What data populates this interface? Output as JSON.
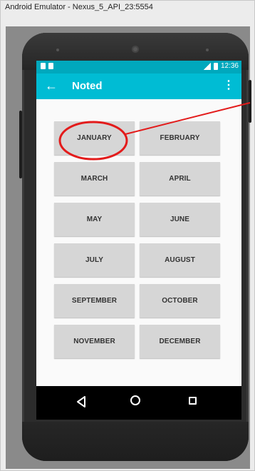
{
  "window": {
    "title": "Android Emulator - Nexus_5_API_23:5554"
  },
  "status_bar": {
    "time": "12:36"
  },
  "app_bar": {
    "title": "Noted",
    "back_icon": "arrow-back-icon",
    "overflow_icon": "more-vert-icon"
  },
  "months": [
    "JANUARY",
    "FEBRUARY",
    "MARCH",
    "APRIL",
    "MAY",
    "JUNE",
    "JULY",
    "AUGUST",
    "SEPTEMBER",
    "OCTOBER",
    "NOVEMBER",
    "DECEMBER"
  ],
  "nav_bar": {
    "back_icon": "nav-back-icon",
    "home_icon": "nav-home-icon",
    "recents_icon": "nav-recents-icon"
  },
  "colors": {
    "primary": "#00bcd4",
    "primary_dark": "#00a8bd",
    "annotation": "#e31b1b",
    "button_bg": "#d6d6d6"
  }
}
